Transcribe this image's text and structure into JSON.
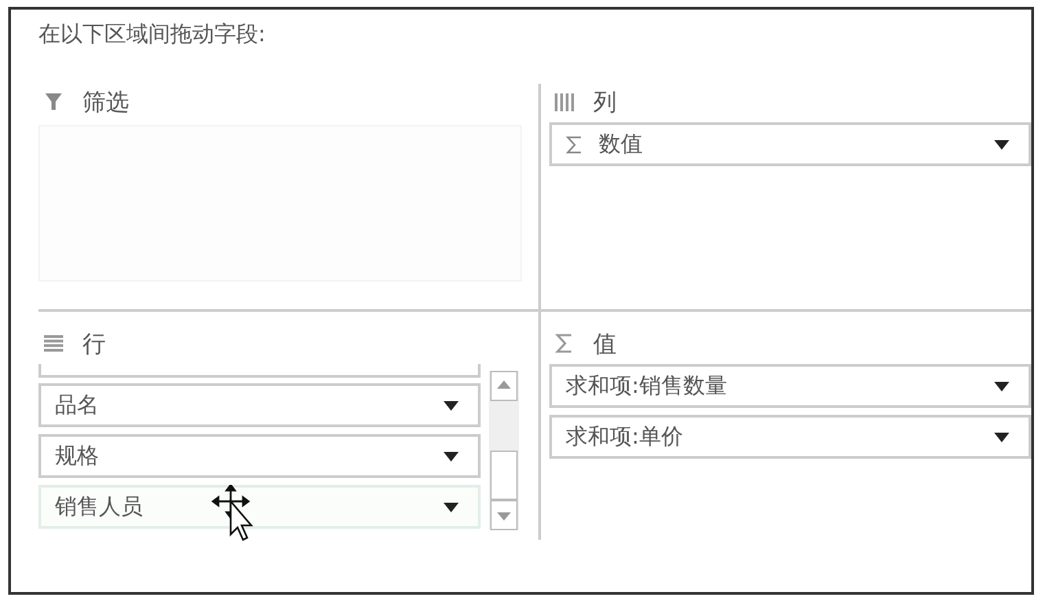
{
  "heading": "在以下区域间拖动字段:",
  "areas": [
    {
      "kind": "filter",
      "label": "筛选"
    },
    {
      "kind": "columns",
      "label": "列",
      "fields": [
        {
          "label": "数值",
          "kind": "values"
        }
      ]
    },
    {
      "kind": "rows",
      "label": "行",
      "clipped_top": true,
      "fields": [
        {
          "label": "品名",
          "kind": "field",
          "hovered": false
        },
        {
          "label": "规格",
          "kind": "field",
          "hovered": false
        },
        {
          "label": "销售人员",
          "kind": "field",
          "hovered": true
        }
      ]
    },
    {
      "kind": "values",
      "label": "值",
      "fields": [
        {
          "label": "求和项:销售数量",
          "kind": "field"
        },
        {
          "label": "求和项:单价",
          "kind": "field"
        }
      ]
    }
  ]
}
